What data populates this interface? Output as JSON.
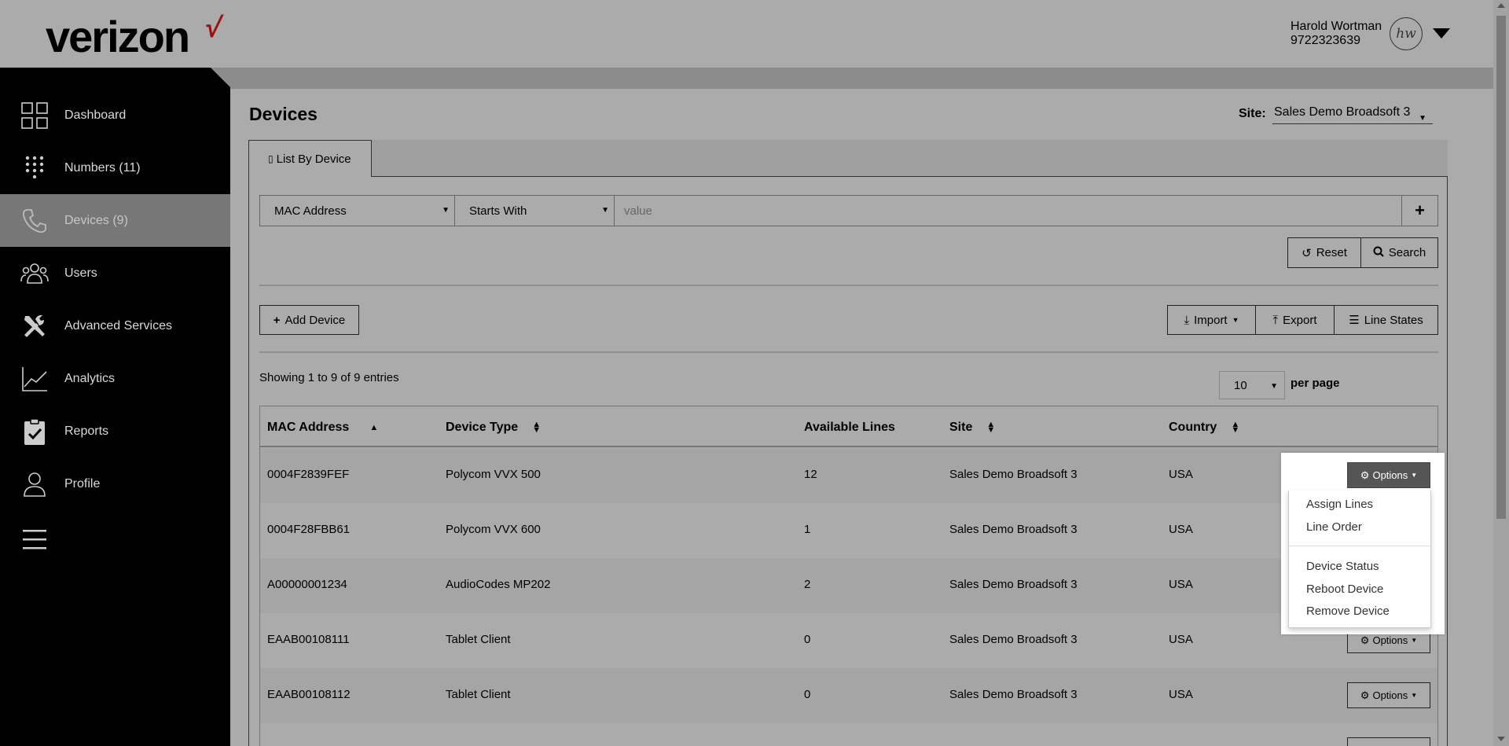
{
  "header": {
    "logo": "verizon",
    "logo_check": "√",
    "user_name": "Harold Wortman",
    "user_phone": "9722323639",
    "avatar_initials": "hw"
  },
  "sidebar": {
    "items": [
      {
        "label": "Dashboard",
        "icon": "dashboard-grid-icon"
      },
      {
        "label": "Numbers (11)",
        "icon": "keypad-icon"
      },
      {
        "label": "Devices (9)",
        "icon": "phone-icon",
        "active": true
      },
      {
        "label": "Users",
        "icon": "users-icon"
      },
      {
        "label": "Advanced Services",
        "icon": "tools-icon"
      },
      {
        "label": "Analytics",
        "icon": "line-chart-icon"
      },
      {
        "label": "Reports",
        "icon": "clipboard-check-icon"
      },
      {
        "label": "Profile",
        "icon": "user-icon"
      }
    ],
    "menu_icon": "hamburger-icon"
  },
  "page": {
    "title": "Devices",
    "site_label": "Site:",
    "site_value": "Sales Demo Broadsoft 3"
  },
  "tabs": [
    {
      "label": "List By Device",
      "icon": "device-icon"
    }
  ],
  "filter": {
    "field": "MAC Address",
    "operator": "Starts With",
    "placeholder": "value",
    "add_label": "+"
  },
  "buttons": {
    "reset": "Reset",
    "search": "Search",
    "add_device": "Add Device",
    "import": "Import",
    "export": "Export",
    "line_states": "Line States"
  },
  "list": {
    "showing": "Showing 1 to 9 of 9 entries",
    "per_page_value": "10",
    "per_page_label": "per page"
  },
  "table": {
    "columns": [
      "MAC Address",
      "Device Type",
      "Available Lines",
      "Site",
      "Country"
    ],
    "rows": [
      {
        "mac": "0004F2839FEF",
        "type": "Polycom VVX 500",
        "lines": "12",
        "site": "Sales Demo Broadsoft 3",
        "country": "USA"
      },
      {
        "mac": "0004F28FBB61",
        "type": "Polycom VVX 600",
        "lines": "1",
        "site": "Sales Demo Broadsoft 3",
        "country": "USA"
      },
      {
        "mac": "A00000001234",
        "type": "AudioCodes MP202",
        "lines": "2",
        "site": "Sales Demo Broadsoft 3",
        "country": "USA"
      },
      {
        "mac": "EAAB00108111",
        "type": "Tablet Client",
        "lines": "0",
        "site": "Sales Demo Broadsoft 3",
        "country": "USA"
      },
      {
        "mac": "EAAB00108112",
        "type": "Tablet Client",
        "lines": "0",
        "site": "Sales Demo Broadsoft 3",
        "country": "USA"
      }
    ],
    "options_label": "Options"
  },
  "dropdown": {
    "items_group1": [
      "Assign Lines",
      "Line Order"
    ],
    "items_group2": [
      "Device Status",
      "Reboot Device",
      "Remove Device"
    ]
  }
}
